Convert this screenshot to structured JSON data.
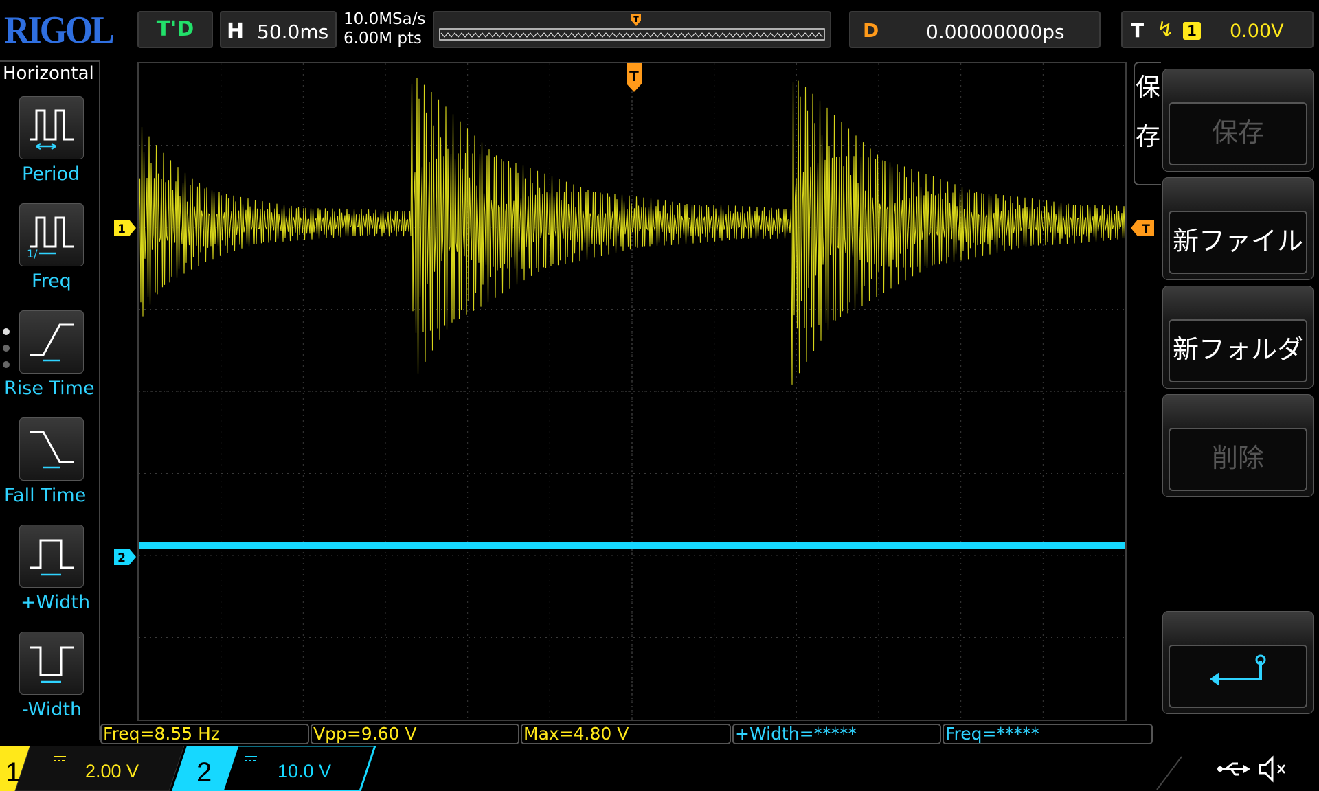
{
  "brand": "RIGOL",
  "status": {
    "mode": "T'D"
  },
  "timebase": {
    "label": "H",
    "value": "50.0ms"
  },
  "acquisition": {
    "sample_rate": "10.0MSa/s",
    "memory_depth": "6.00M pts"
  },
  "delay": {
    "label": "D",
    "value": "0.00000000ps"
  },
  "trigger": {
    "label": "T",
    "edge_icon": "rising-edge-icon",
    "source": "1",
    "level": "0.00V"
  },
  "measure_menu": {
    "title": "Horizontal",
    "items": [
      {
        "label": "Period",
        "icon": "period-icon"
      },
      {
        "label": "Freq",
        "icon": "freq-icon"
      },
      {
        "label": "Rise Time",
        "icon": "rise-time-icon"
      },
      {
        "label": "Fall Time",
        "icon": "fall-time-icon"
      },
      {
        "label": "+Width",
        "icon": "positive-width-icon"
      },
      {
        "label": "-Width",
        "icon": "negative-width-icon"
      }
    ]
  },
  "save_menu": {
    "tab_chars": [
      "保",
      "存"
    ],
    "softkeys": [
      {
        "label": "保存",
        "enabled": false
      },
      {
        "label": "新ファイル",
        "enabled": true
      },
      {
        "label": "新フォルダ",
        "enabled": true
      },
      {
        "label": "削除",
        "enabled": false
      },
      {
        "label": "",
        "icon": "enter-icon",
        "enabled": true
      }
    ]
  },
  "markers": {
    "ch1": "1",
    "ch2": "2",
    "trigger_pos": "T",
    "trigger_level": "T"
  },
  "measurements": [
    "Freq=8.55 Hz",
    "Vpp=9.60 V",
    "Max=4.80 V",
    "+Width=*****",
    "Freq=*****"
  ],
  "channels": [
    {
      "number": "1",
      "coupling_icon": "dc-coupling-icon",
      "scale": "2.00 V",
      "color": "#ffe81a"
    },
    {
      "number": "2",
      "coupling_icon": "dc-coupling-icon",
      "scale": "10.0 V",
      "color": "#16d8ff"
    }
  ],
  "status_icons": [
    "usb-icon",
    "speaker-muted-icon"
  ],
  "colors": {
    "ch1": "#e6e61a",
    "ch2": "#16d8ff",
    "trigger": "#ff9a1a",
    "accent": "#2fd3ff"
  }
}
